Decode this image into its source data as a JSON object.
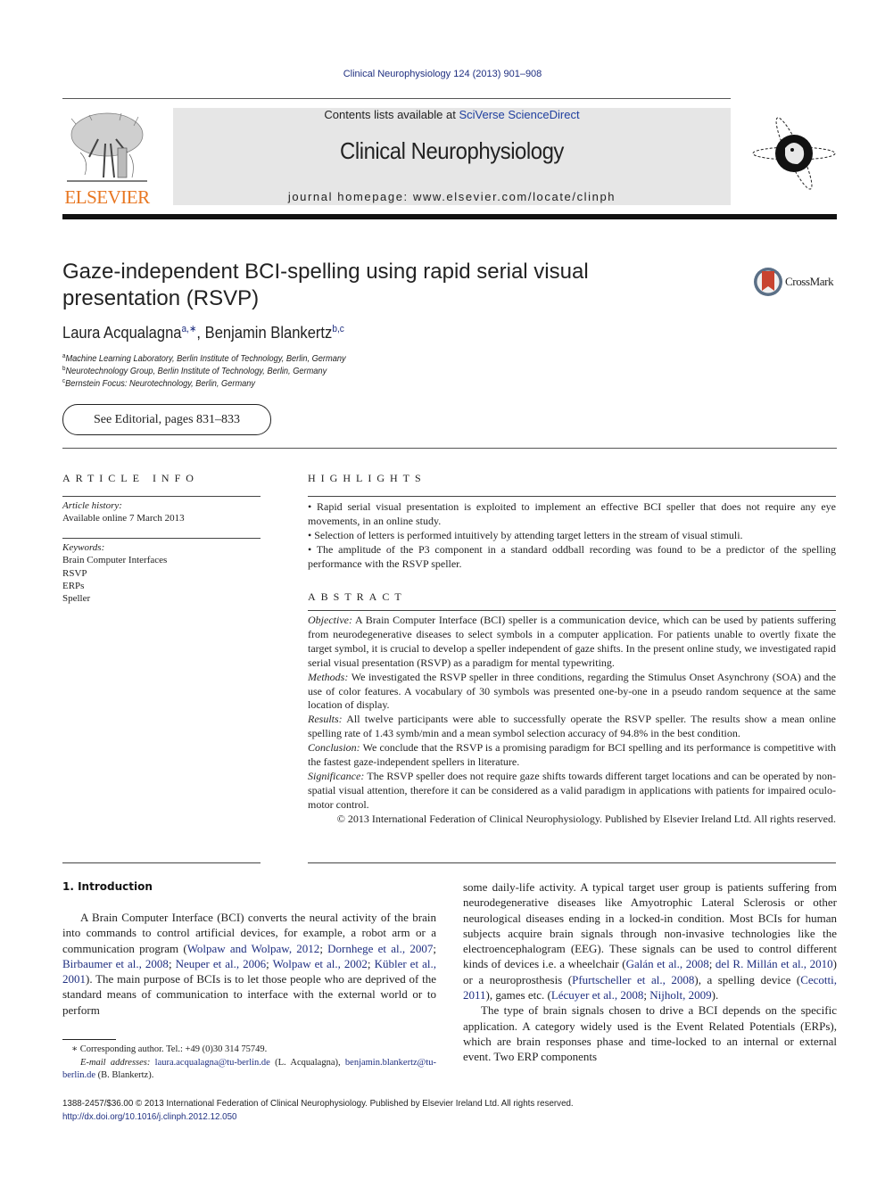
{
  "header": {
    "citation": "Clinical Neurophysiology 124 (2013) 901–908",
    "contents_prefix": "Contents lists available at ",
    "contents_link": "SciVerse ScienceDirect",
    "journal_name": "Clinical Neurophysiology",
    "homepage_prefix": "journal homepage: ",
    "homepage_url": "www.elsevier.com/locate/clinph",
    "publisher_logo_text": "ELSEVIER",
    "colors": {
      "publisher_orange": "#e87722",
      "link_blue": "#1f2f80",
      "header_gray": "#e6e6e6"
    }
  },
  "article": {
    "title": "Gaze-independent BCI-spelling using rapid serial visual presentation (RSVP)",
    "crossmark_label": "CrossMark",
    "authors": [
      {
        "name": "Laura Acqualagna",
        "sup": "a,∗"
      },
      {
        "name": "Benjamin Blankertz",
        "sup": "b,c"
      }
    ],
    "affiliations": [
      {
        "mark": "a",
        "text": "Machine Learning Laboratory, Berlin Institute of Technology, Berlin, Germany"
      },
      {
        "mark": "b",
        "text": "Neurotechnology Group, Berlin Institute of Technology, Berlin, Germany"
      },
      {
        "mark": "c",
        "text": "Bernstein Focus: Neurotechnology, Berlin, Germany"
      }
    ],
    "editorial_link": "See Editorial, pages 831–833"
  },
  "article_info": {
    "heading": "ARTICLE INFO",
    "history_label": "Article history:",
    "history_value": "Available online 7 March 2013",
    "keywords_label": "Keywords:",
    "keywords": [
      "Brain Computer Interfaces",
      "RSVP",
      "ERPs",
      "Speller"
    ]
  },
  "highlights": {
    "heading": "HIGHLIGHTS",
    "items": [
      "• Rapid serial visual presentation is exploited to implement an effective BCI speller that does not require any eye movements, in an online study.",
      "• Selection of letters is performed intuitively by attending target letters in the stream of visual stimuli.",
      "• The amplitude of the P3 component in a standard oddball recording was found to be a predictor of the spelling performance with the RSVP speller."
    ]
  },
  "abstract": {
    "heading": "ABSTRACT",
    "sections": [
      {
        "label": "Objective:",
        "text": " A Brain Computer Interface (BCI) speller is a communication device, which can be used by patients suffering from neurodegenerative diseases to select symbols in a computer application. For patients unable to overtly fixate the target symbol, it is crucial to develop a speller independent of gaze shifts. In the present online study, we investigated rapid serial visual presentation (RSVP) as a paradigm for mental typewriting."
      },
      {
        "label": "Methods:",
        "text": " We investigated the RSVP speller in three conditions, regarding the Stimulus Onset Asynchrony (SOA) and the use of color features. A vocabulary of 30 symbols was presented one-by-one in a pseudo random sequence at the same location of display."
      },
      {
        "label": "Results:",
        "text": " All twelve participants were able to successfully operate the RSVP speller. The results show a mean online spelling rate of 1.43 symb/min and a mean symbol selection accuracy of 94.8% in the best condition."
      },
      {
        "label": "Conclusion:",
        "text": " We conclude that the RSVP is a promising paradigm for BCI spelling and its performance is competitive with the fastest gaze-independent spellers in literature."
      },
      {
        "label": "Significance:",
        "text": " The RSVP speller does not require gaze shifts towards different target locations and can be operated by non-spatial visual attention, therefore it can be considered as a valid paradigm in applications with patients for impaired oculo-motor control."
      }
    ],
    "copyright": "© 2013 International Federation of Clinical Neurophysiology. Published by Elsevier Ireland Ltd. All rights reserved."
  },
  "introduction": {
    "heading": "1. Introduction",
    "left": {
      "p1_a": "A Brain Computer Interface (BCI) converts the neural activity of the brain into commands to control artificial devices, for example, a robot arm or a communication program (",
      "p1_refs": [
        "Wolpaw and Wolpaw, 2012",
        "Dornhege et al., 2007",
        "Birbaumer et al., 2008",
        "Neuper et al., 2006",
        "Wolpaw et al., 2002",
        "Kübler et al., 2001"
      ],
      "p1_b": "). The main purpose of BCIs is to let those people who are deprived of the standard means of communication to interface with the external world or to perform"
    },
    "right": {
      "p1_a": "some daily-life activity. A typical target user group is patients suffering from neurodegenerative diseases like Amyotrophic Lateral Sclerosis or other neurological diseases ending in a locked-in condition. Most BCIs for human subjects acquire brain signals through non-invasive technologies like the electroencephalogram (EEG). These signals can be used to control different kinds of devices i.e. a wheelchair (",
      "ref_wheelchair": [
        "Galán et al., 2008",
        "del R. Millán et al., 2010"
      ],
      "p1_b": ") or a neuroprosthesis (",
      "ref_neuro": "Pfurtscheller et al., 2008",
      "p1_c": "), a spelling device (",
      "ref_spelling": "Cecotti, 2011",
      "p1_d": "), games etc. (",
      "ref_games": [
        "Lécuyer et al., 2008",
        "Nijholt, 2009"
      ],
      "p1_e": ").",
      "p2": "The type of brain signals chosen to drive a BCI depends on the specific application. A category widely used is the Event Related Potentials (ERPs), which are brain responses phase and time-locked to an internal or external event. Two ERP components"
    }
  },
  "footnote": {
    "corresponding": "∗ Corresponding author. Tel.: +49 (0)30 314 75749.",
    "email_label": "E-mail addresses:",
    "email1": "laura.acqualagna@tu-berlin.de",
    "email1_owner": " (L. Acqualagna), ",
    "email2": "benjamin.blankertz@tu-berlin.de",
    "email2_owner": " (B. Blankertz)."
  },
  "bottom": {
    "issn_line": "1388-2457/$36.00 © 2013 International Federation of Clinical Neurophysiology. Published by Elsevier Ireland Ltd. All rights reserved.",
    "doi": "http://dx.doi.org/10.1016/j.clinph.2012.12.050"
  }
}
